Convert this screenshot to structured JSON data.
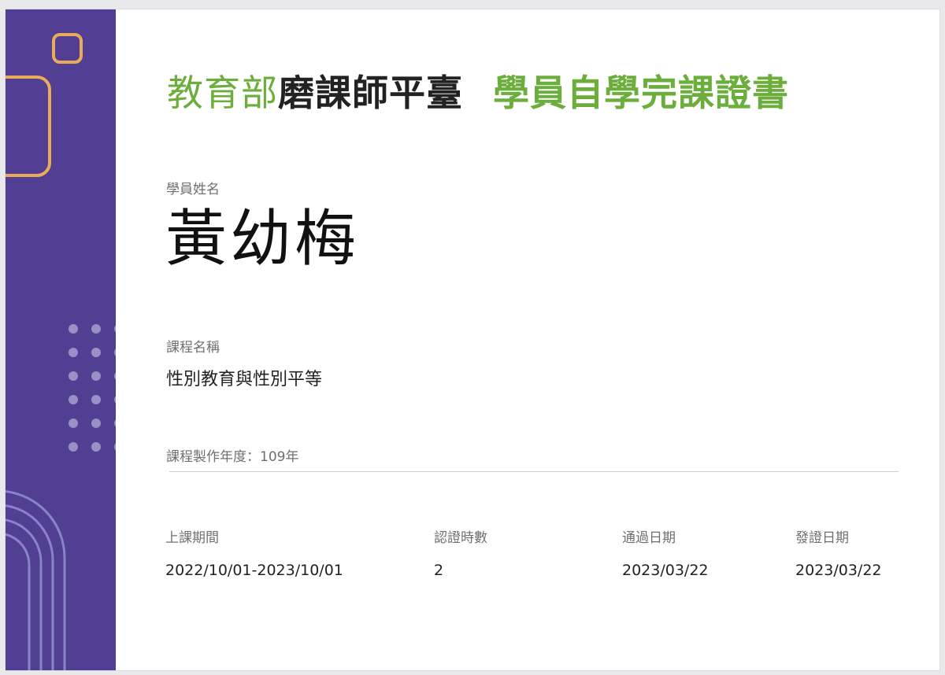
{
  "certificate": {
    "title": {
      "org": "教育部",
      "platform": "磨課師平臺",
      "cert_type": "學員自學完課證書"
    },
    "student": {
      "label": "學員姓名",
      "name": "黃幼梅"
    },
    "course": {
      "label": "課程名稱",
      "name": "性別教育與性別平等"
    },
    "production_year": "課程製作年度：109年",
    "details": {
      "period": {
        "label": "上課期間",
        "value": "2022/10/01-2023/10/01"
      },
      "hours": {
        "label": "認證時數",
        "value": "2"
      },
      "pass_date": {
        "label": "通過日期",
        "value": "2023/03/22"
      },
      "issue_date": {
        "label": "發證日期",
        "value": "2023/03/22"
      }
    },
    "colors": {
      "band": "#523f93",
      "accent_green": "#6cae3c",
      "accent_orange": "#e8ac5a",
      "dots": "#9a8fc6",
      "arcs": "#8a83c9"
    }
  }
}
